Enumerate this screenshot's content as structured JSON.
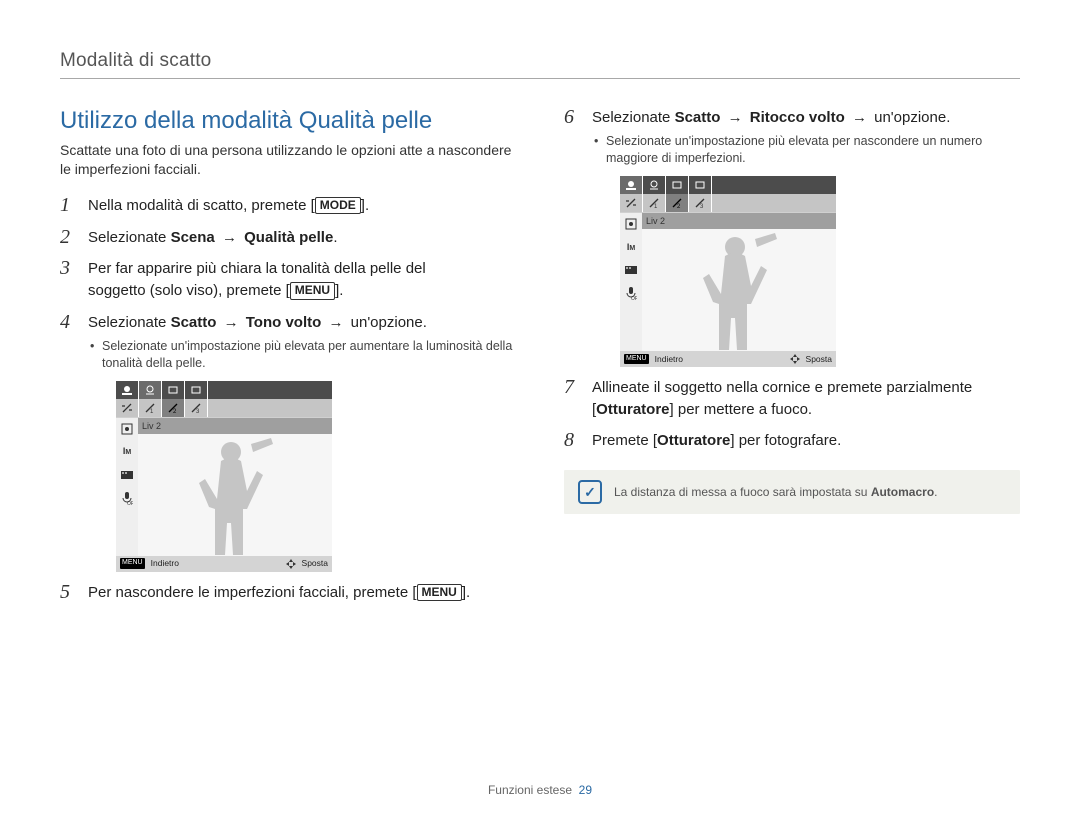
{
  "header": "Modalità di scatto",
  "section_title": "Utilizzo della modalità Qualità pelle",
  "intro": "Scattate una foto di una persona utilizzando le opzioni atte a nascondere le imperfezioni facciali.",
  "key_mode": "MODE",
  "key_menu": "MENU",
  "arrow": "→",
  "steps_left": {
    "s1": {
      "num": "1",
      "pre": "Nella modalità di scatto, premete [",
      "post": "]."
    },
    "s2": {
      "num": "2",
      "pre": "Selezionate ",
      "b1": "Scena",
      "b2": "Qualità pelle",
      "post": "."
    },
    "s3": {
      "num": "3",
      "line1": "Per far apparire più chiara la tonalità della pelle del",
      "line2a": "soggetto (solo viso), premete [",
      "line2b": "]."
    },
    "s4": {
      "num": "4",
      "pre": "Selezionate ",
      "b1": "Scatto",
      "b2": "Tono volto",
      "post": " un'opzione.",
      "sub": "Selezionate un'impostazione più elevata per aumentare la luminosità della tonalità della pelle."
    },
    "s5": {
      "num": "5",
      "pre": "Per nascondere le imperfezioni facciali, premete [",
      "post": "]."
    }
  },
  "steps_right": {
    "s6": {
      "num": "6",
      "pre": "Selezionate ",
      "b1": "Scatto",
      "b2": "Ritocco volto",
      "post": " un'opzione.",
      "sub": "Selezionate un'impostazione più elevata per nascondere un numero maggiore di imperfezioni."
    },
    "s7": {
      "num": "7",
      "line1": "Allineate il soggetto nella cornice e premete parzialmente",
      "line2a": "[",
      "b": "Otturatore",
      "line2b": "] per mettere a fuoco."
    },
    "s8": {
      "num": "8",
      "pre": "Premete [",
      "b": "Otturatore",
      "post": "] per fotografare."
    }
  },
  "note": {
    "pre": "La distanza di messa a fuoco sarà impostata su ",
    "b": "Automacro",
    "post": "."
  },
  "screen": {
    "liv_label": "Liv 2",
    "back_key": "MENU",
    "back_label": "Indietro",
    "move_label": "Sposta"
  },
  "footer": {
    "section": "Funzioni estese",
    "page": "29"
  }
}
